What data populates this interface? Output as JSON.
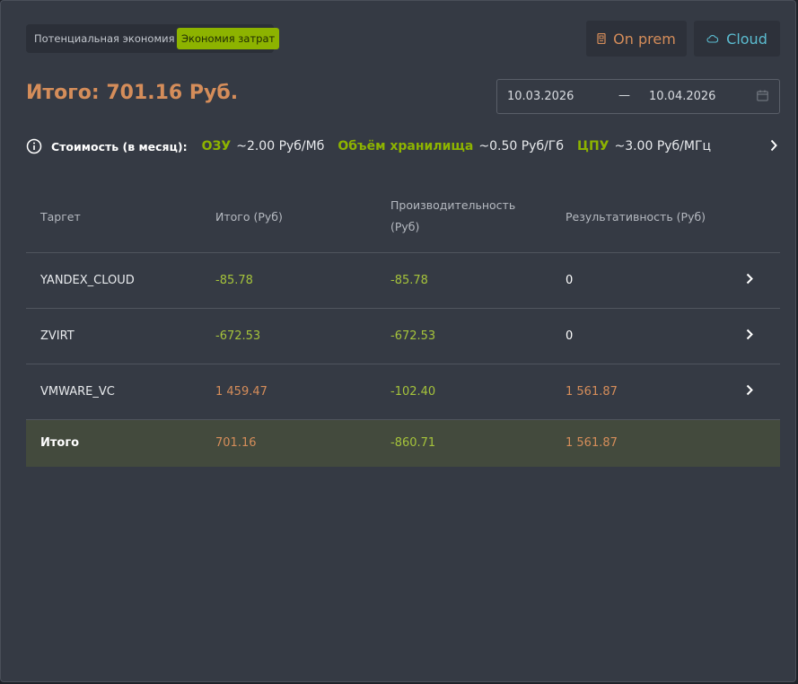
{
  "toggle": {
    "option_potential": "Потенциальная экономия",
    "option_savings": "Экономия затрат"
  },
  "buttons": {
    "onprem_label": "On prem",
    "cloud_label": "Cloud"
  },
  "summary": {
    "total_label": "Итого: 701.16 Руб."
  },
  "date_range": {
    "from": "10.03.2026",
    "separator": "—",
    "to": "10.04.2026"
  },
  "cost": {
    "label": "Стоимость (в месяц):",
    "items": [
      {
        "key": "ОЗУ",
        "value": "~2.00 Руб/Мб"
      },
      {
        "key": "Объём хранилища",
        "value": "~0.50 Руб/Гб"
      },
      {
        "key": "ЦПУ",
        "value": "~3.00 Руб/МГц"
      }
    ]
  },
  "table": {
    "headers": {
      "target": "Таргет",
      "total": "Итого (Руб)",
      "performance_line1": "Производительность",
      "performance_line2": "(Руб)",
      "efficiency": "Результативность (Руб)"
    },
    "rows": [
      {
        "target": "YANDEX_CLOUD",
        "total": "-85.78",
        "performance": "-85.78",
        "efficiency": "0"
      },
      {
        "target": "ZVIRT",
        "total": "-672.53",
        "performance": "-672.53",
        "efficiency": "0"
      },
      {
        "target": "VMWARE_VC",
        "total": "1 459.47",
        "performance": "-102.40",
        "efficiency": "1 561.87"
      }
    ],
    "total_row": {
      "target": "Итого",
      "total": "701.16",
      "performance": "-860.71",
      "efficiency": "1 561.87"
    }
  },
  "colors": {
    "accent_orange": "#d58d5a",
    "accent_green": "#8db300",
    "accent_cyan": "#5bbcd0"
  },
  "icons": {
    "onprem": "server-icon",
    "cloud": "cloud-icon",
    "calendar": "calendar-icon",
    "info": "info-icon",
    "chevron": "chevron-right-icon"
  }
}
